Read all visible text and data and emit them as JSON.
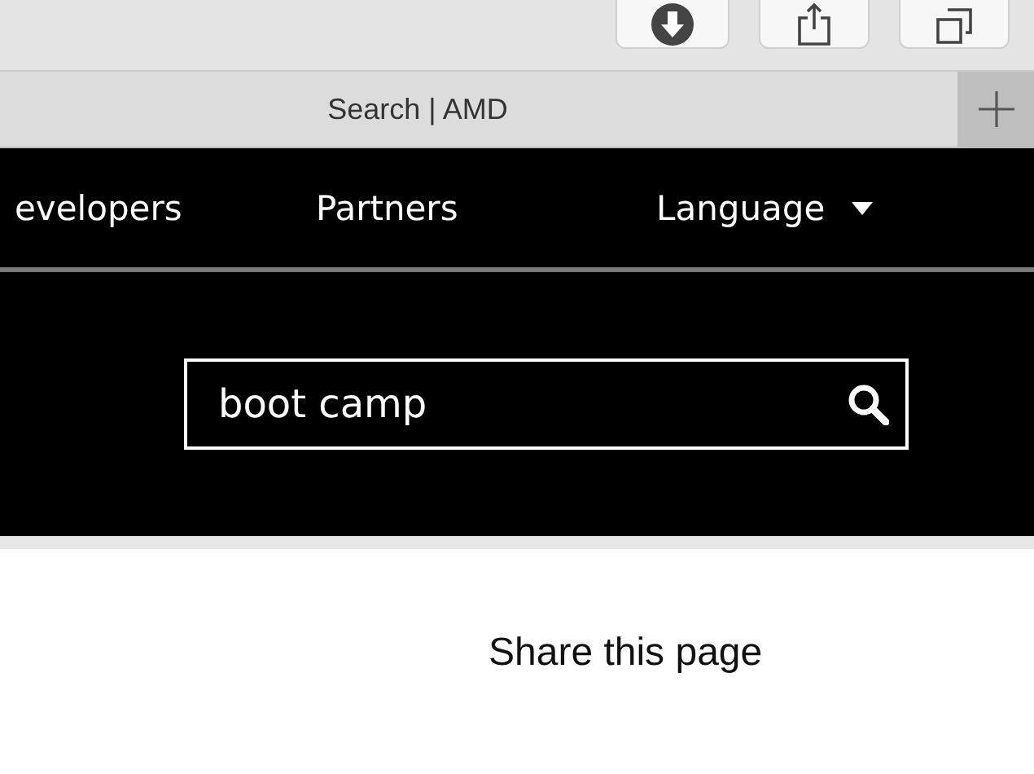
{
  "toolbar": {
    "buttons": [
      {
        "kind": "download"
      },
      {
        "kind": "share"
      },
      {
        "kind": "tabs"
      }
    ]
  },
  "tab_bar": {
    "tabs": [
      {
        "title": "Search | AMD",
        "selected": true
      }
    ]
  },
  "nav": {
    "items": [
      {
        "label": "evelopers",
        "kind": "link"
      },
      {
        "label": "Partners",
        "kind": "link"
      },
      {
        "label": "Language",
        "kind": "dropdown"
      }
    ]
  },
  "search": {
    "value": "boot camp"
  },
  "share": {
    "label": "Share this page"
  }
}
